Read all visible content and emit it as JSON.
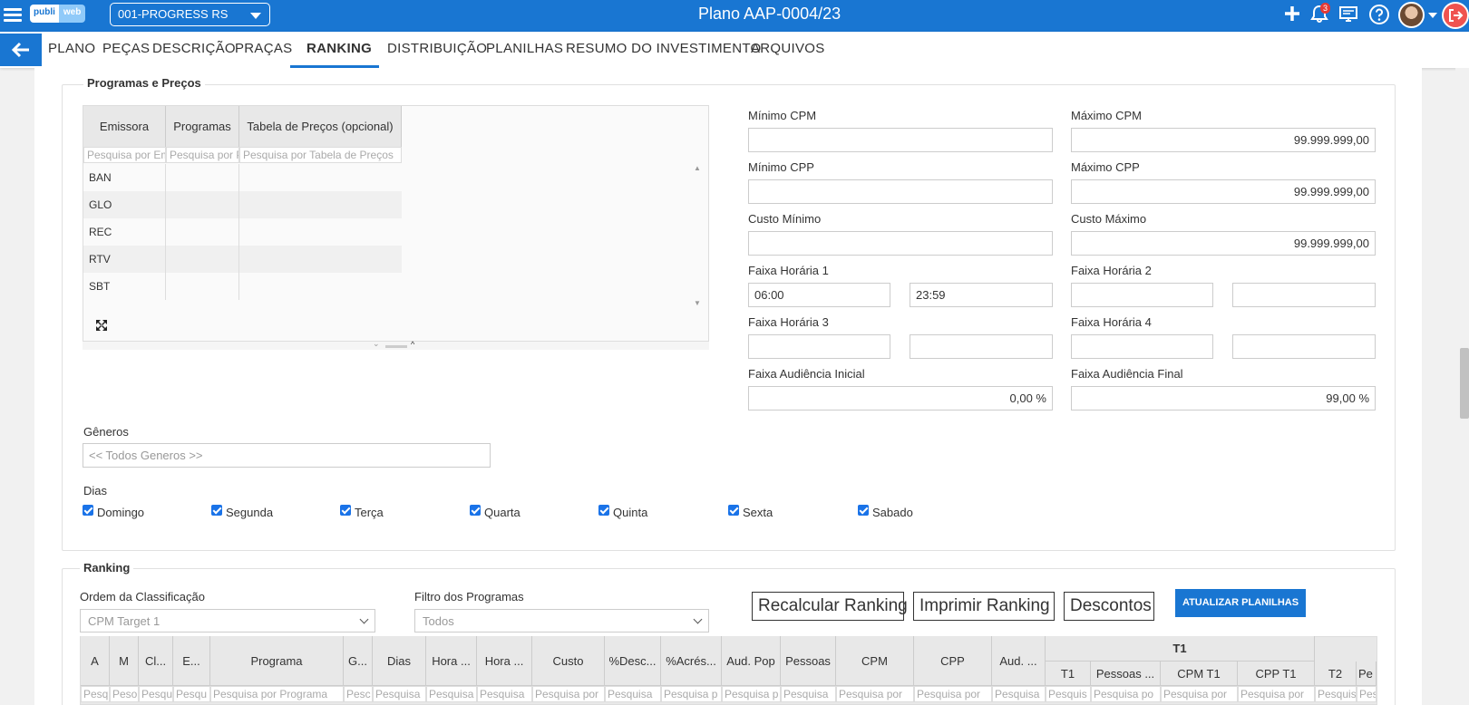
{
  "header": {
    "logo_part1": "publi",
    "logo_part2": "web",
    "company": "001-PROGRESS RS",
    "plan_title": "Plano AAP-0004/23",
    "notification_count": "3",
    "icons": [
      "menu-icon",
      "plus-icon",
      "bell-icon",
      "monitor-icon",
      "help-icon",
      "user-avatar",
      "logout-icon"
    ]
  },
  "nav": {
    "back_icon": "←",
    "tabs": [
      "PLANO",
      "PEÇAS",
      "DESCRIÇÃO",
      "PRAÇAS",
      "RANKING",
      "DISTRIBUIÇÃO",
      "PLANILHAS",
      "RESUMO DO INVESTIMENTO",
      "ARQUIVOS"
    ],
    "active_tab": "RANKING"
  },
  "programas": {
    "legend": "Programas e Preços",
    "columns": [
      "Emissora",
      "Programas",
      "Tabela de Preços (opcional)"
    ],
    "filters": [
      "Pesquisa por Emissora",
      "Pesquisa por Programas",
      "Pesquisa por Tabela de Preços"
    ],
    "rows": [
      "BAN",
      "GLO",
      "REC",
      "RTV",
      "SBT"
    ]
  },
  "filters": {
    "min_cpm": {
      "label": "Mínimo CPM",
      "value": ""
    },
    "max_cpm": {
      "label": "Máximo CPM",
      "value": "99.999.999,00"
    },
    "min_cpp": {
      "label": "Mínimo CPP",
      "value": ""
    },
    "max_cpp": {
      "label": "Máximo CPP",
      "value": "99.999.999,00"
    },
    "custo_min": {
      "label": "Custo Mínimo",
      "value": ""
    },
    "custo_max": {
      "label": "Custo Máximo",
      "value": "99.999.999,00"
    },
    "faixa1": {
      "label": "Faixa Horária 1",
      "start": "06:00",
      "end": "23:59"
    },
    "faixa2": {
      "label": "Faixa Horária 2",
      "start": "",
      "end": ""
    },
    "faixa3": {
      "label": "Faixa Horária 3",
      "start": "",
      "end": ""
    },
    "faixa4": {
      "label": "Faixa Horária 4",
      "start": "",
      "end": ""
    },
    "aud_ini": {
      "label": "Faixa Audiência Inicial",
      "value": "0,00 %"
    },
    "aud_fim": {
      "label": "Faixa Audiência Final",
      "value": "99,00 %"
    }
  },
  "generos": {
    "label": "Gêneros",
    "value": "<< Todos Generos >>"
  },
  "dias": {
    "label": "Dias",
    "items": [
      {
        "name": "Domingo",
        "checked": true
      },
      {
        "name": "Segunda",
        "checked": true
      },
      {
        "name": "Terça",
        "checked": true
      },
      {
        "name": "Quarta",
        "checked": true
      },
      {
        "name": "Quinta",
        "checked": true
      },
      {
        "name": "Sexta",
        "checked": true
      },
      {
        "name": "Sabado",
        "checked": true
      }
    ]
  },
  "ranking": {
    "legend": "Ranking",
    "ordem_label": "Ordem da Classificação",
    "ordem_value": "CPM Target 1",
    "filtro_label": "Filtro dos Programas",
    "filtro_value": "Todos",
    "btn_recalcular": "Recalcular Ranking",
    "btn_imprimir": "Imprimir Ranking",
    "btn_descontos": "Descontos",
    "btn_atualizar": "ATUALIZAR PLANILHAS",
    "group_header": "T1",
    "columns": [
      "A",
      "M",
      "Cl...",
      "E...",
      "Programa",
      "G...",
      "Dias",
      "Hora ...",
      "Hora ...",
      "Custo",
      "%Desc...",
      "%Acrés...",
      "Aud. Pop",
      "Pessoas",
      "CPM",
      "CPP",
      "Aud. ...",
      "T1",
      "Pessoas ...",
      "CPM T1",
      "CPP T1",
      "T2",
      "Pe"
    ],
    "filters": [
      "Pesq",
      "Peso",
      "Pesqu",
      "Pesqu",
      "Pesquisa por Programa",
      "Pesc",
      "Pesquisa",
      "Pesquisa",
      "Pesquisa",
      "Pesquisa por",
      "Pesquisa",
      "Pesquisa p",
      "Pesquisa p",
      "Pesquisa",
      "Pesquisa por",
      "Pesquisa por",
      "Pesquisa",
      "Pesquis",
      "Pesquisa po",
      "Pesquisa por",
      "Pesquisa por",
      "Pesquis",
      "Pesq"
    ]
  }
}
